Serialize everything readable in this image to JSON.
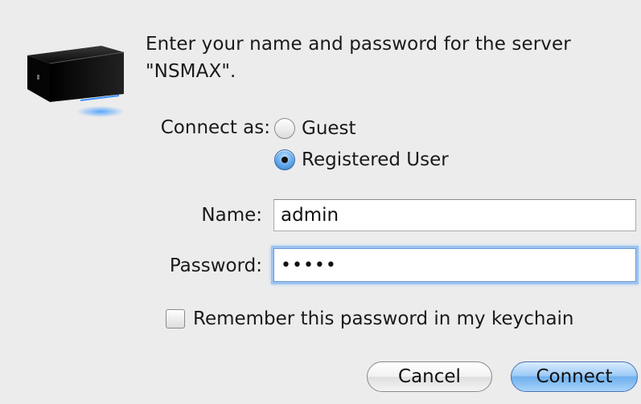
{
  "dialog": {
    "prompt": "Enter your name and password for the server \"NSMAX\".",
    "icon": "external-hard-drive-icon"
  },
  "connect_as": {
    "label": "Connect as:",
    "options": [
      "Guest",
      "Registered User"
    ],
    "selected": "Registered User"
  },
  "name_field": {
    "label": "Name:",
    "value": "admin"
  },
  "password_field": {
    "label": "Password:",
    "value": "•••••"
  },
  "keychain": {
    "label": "Remember this password in my keychain",
    "checked": false
  },
  "buttons": {
    "cancel": "Cancel",
    "connect": "Connect"
  },
  "colors": {
    "background": "#ececec",
    "default_button": "#6fb0ee",
    "focus_ring": "#9cc3ef"
  }
}
